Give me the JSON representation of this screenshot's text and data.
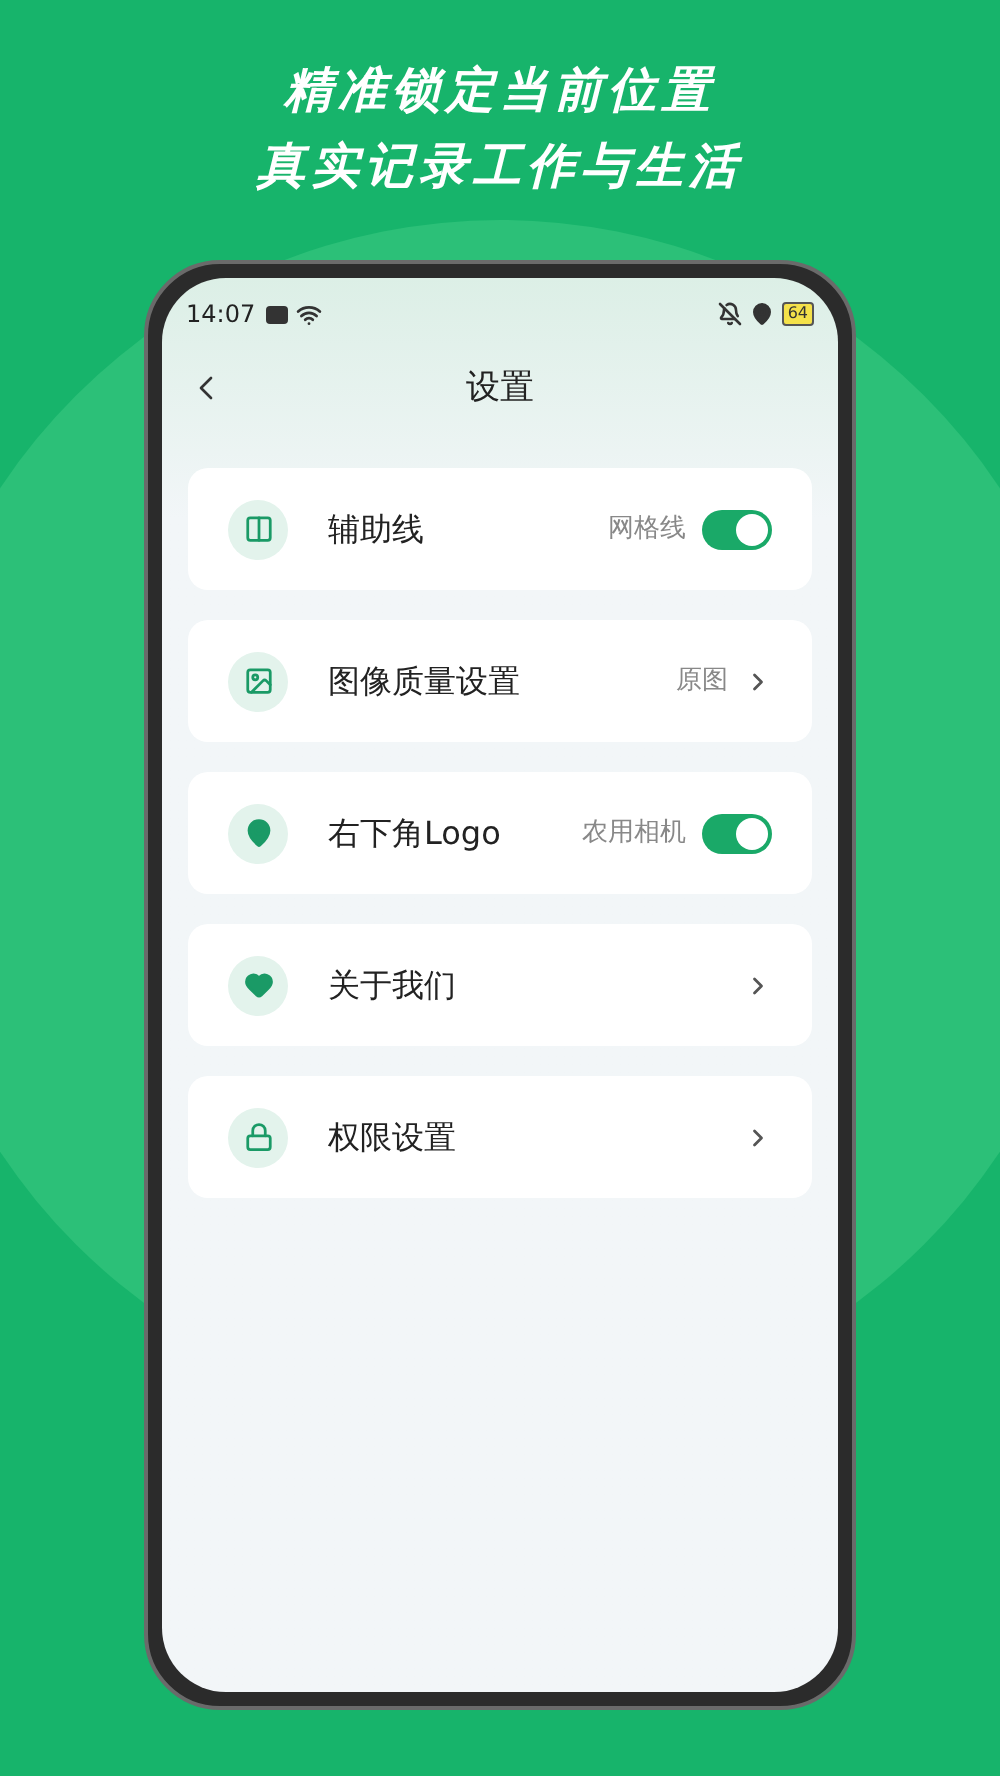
{
  "headline": [
    "精准锁定当前位置",
    "真实记录工作与生活"
  ],
  "status_bar": {
    "time": "14:07",
    "battery": "64"
  },
  "header": {
    "title": "设置"
  },
  "items": [
    {
      "kind": "toggle",
      "label": "辅助线",
      "value": "网格线",
      "on": true
    },
    {
      "kind": "link",
      "label": "图像质量设置",
      "value": "原图"
    },
    {
      "kind": "toggle",
      "label": "右下角Logo",
      "value": "农用相机",
      "on": true
    },
    {
      "kind": "link",
      "label": "关于我们"
    },
    {
      "kind": "link",
      "label": "权限设置"
    }
  ]
}
